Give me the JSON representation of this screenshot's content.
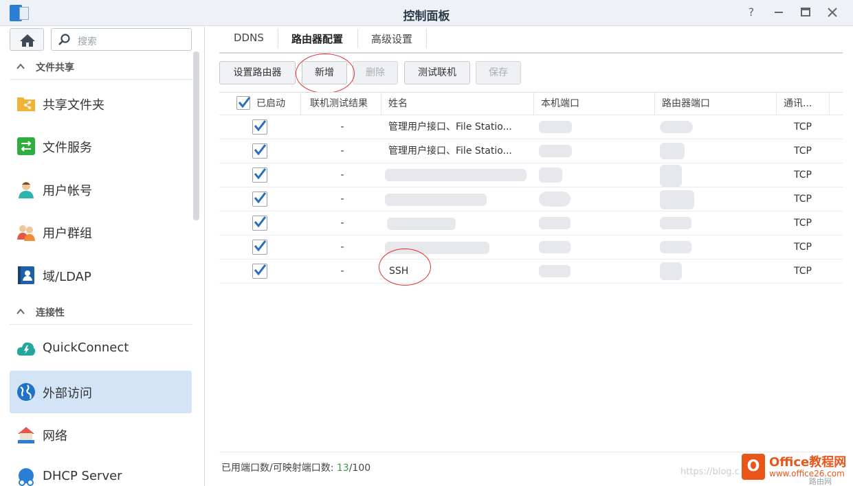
{
  "window": {
    "title": "控制面板",
    "controls": [
      "help-icon",
      "minimize-icon",
      "maximize-icon",
      "close-icon"
    ]
  },
  "sidebar": {
    "search_placeholder": "搜索",
    "sections": [
      {
        "label": "文件共享"
      },
      {
        "label": "连接性"
      }
    ],
    "items": [
      {
        "label": "共享文件夹",
        "icon": "shared-folder-icon"
      },
      {
        "label": "文件服务",
        "icon": "file-services-icon"
      },
      {
        "label": "用户帐号",
        "icon": "user-icon"
      },
      {
        "label": "用户群组",
        "icon": "group-icon"
      },
      {
        "label": "域/LDAP",
        "icon": "ldap-icon"
      },
      {
        "label": "QuickConnect",
        "icon": "quickconnect-icon"
      },
      {
        "label": "外部访问",
        "icon": "globe-icon",
        "active": true
      },
      {
        "label": "网络",
        "icon": "network-icon"
      },
      {
        "label": "DHCP Server",
        "icon": "dhcp-icon"
      }
    ]
  },
  "tabs": [
    {
      "label": "DDNS"
    },
    {
      "label": "路由器配置",
      "selected": true
    },
    {
      "label": "高级设置"
    }
  ],
  "toolbar": {
    "setup_router": "设置路由器",
    "add": "新增",
    "delete": "删除",
    "test_connection": "测试联机",
    "save": "保存"
  },
  "grid": {
    "columns": [
      "已启动",
      "联机测试结果",
      "姓名",
      "本机端口",
      "路由器端口",
      "通讯..."
    ],
    "rows": [
      {
        "enabled": true,
        "test": "-",
        "name": "管理用户接口、File Statio...",
        "protocol": "TCP"
      },
      {
        "enabled": true,
        "test": "-",
        "name": "管理用户接口、File Statio...",
        "protocol": "TCP"
      },
      {
        "enabled": true,
        "test": "-",
        "name": "",
        "protocol": "TCP"
      },
      {
        "enabled": true,
        "test": "-",
        "name": "",
        "protocol": "TCP"
      },
      {
        "enabled": true,
        "test": "-",
        "name": "",
        "protocol": "TCP"
      },
      {
        "enabled": true,
        "test": "-",
        "name": "",
        "protocol": "TCP"
      },
      {
        "enabled": true,
        "test": "-",
        "name": "SSH",
        "protocol": "TCP"
      }
    ]
  },
  "footer": {
    "label": "已用端口数/可映射端口数:",
    "used": "13",
    "total": "/100"
  },
  "watermark": {
    "blog": "https://blog.c",
    "logo_mark": "O",
    "logo_title": "Office教程网",
    "logo_url": "www.office26.com",
    "logo_sub": "路由网"
  },
  "colors": {
    "accent": "#2a7fd4",
    "active_nav": "#d3e4f6",
    "used_count": "#3a9a3a",
    "annotation": "#e03030"
  }
}
